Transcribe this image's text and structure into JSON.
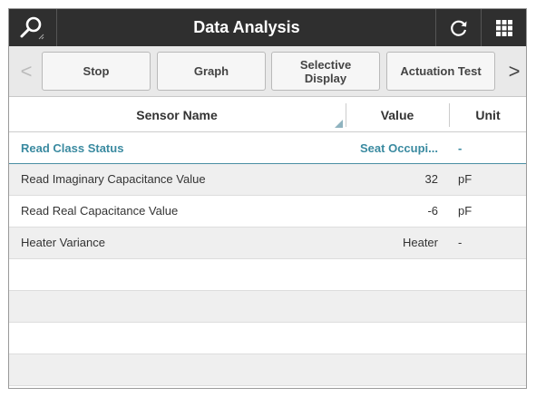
{
  "header": {
    "title": "Data Analysis",
    "left_icon": "search-icon",
    "right_icons": [
      "refresh-icon",
      "grid-menu-icon"
    ],
    "background": "#2f2f2f"
  },
  "toolbar": {
    "buttons": [
      {
        "label": "Stop"
      },
      {
        "label": "Graph"
      },
      {
        "label": "Selective\nDisplay"
      },
      {
        "label": "Actuation Test"
      }
    ],
    "prev_arrow": "<",
    "next_arrow": ">"
  },
  "table": {
    "columns": [
      "Sensor Name",
      "Value",
      "Unit"
    ],
    "rows": [
      {
        "name": "Read Class Status",
        "value": "Seat Occupi...",
        "unit": "-"
      },
      {
        "name": "Read Imaginary Capacitance Value",
        "value": "32",
        "unit": "pF"
      },
      {
        "name": "Read Real Capacitance Value",
        "value": "-6",
        "unit": "pF"
      },
      {
        "name": "Heater Variance",
        "value": "Heater",
        "unit": "-"
      },
      {
        "name": "",
        "value": "",
        "unit": ""
      },
      {
        "name": "",
        "value": "",
        "unit": ""
      },
      {
        "name": "",
        "value": "",
        "unit": ""
      },
      {
        "name": "",
        "value": "",
        "unit": ""
      }
    ],
    "highlight_color": "#3a8aa0"
  }
}
